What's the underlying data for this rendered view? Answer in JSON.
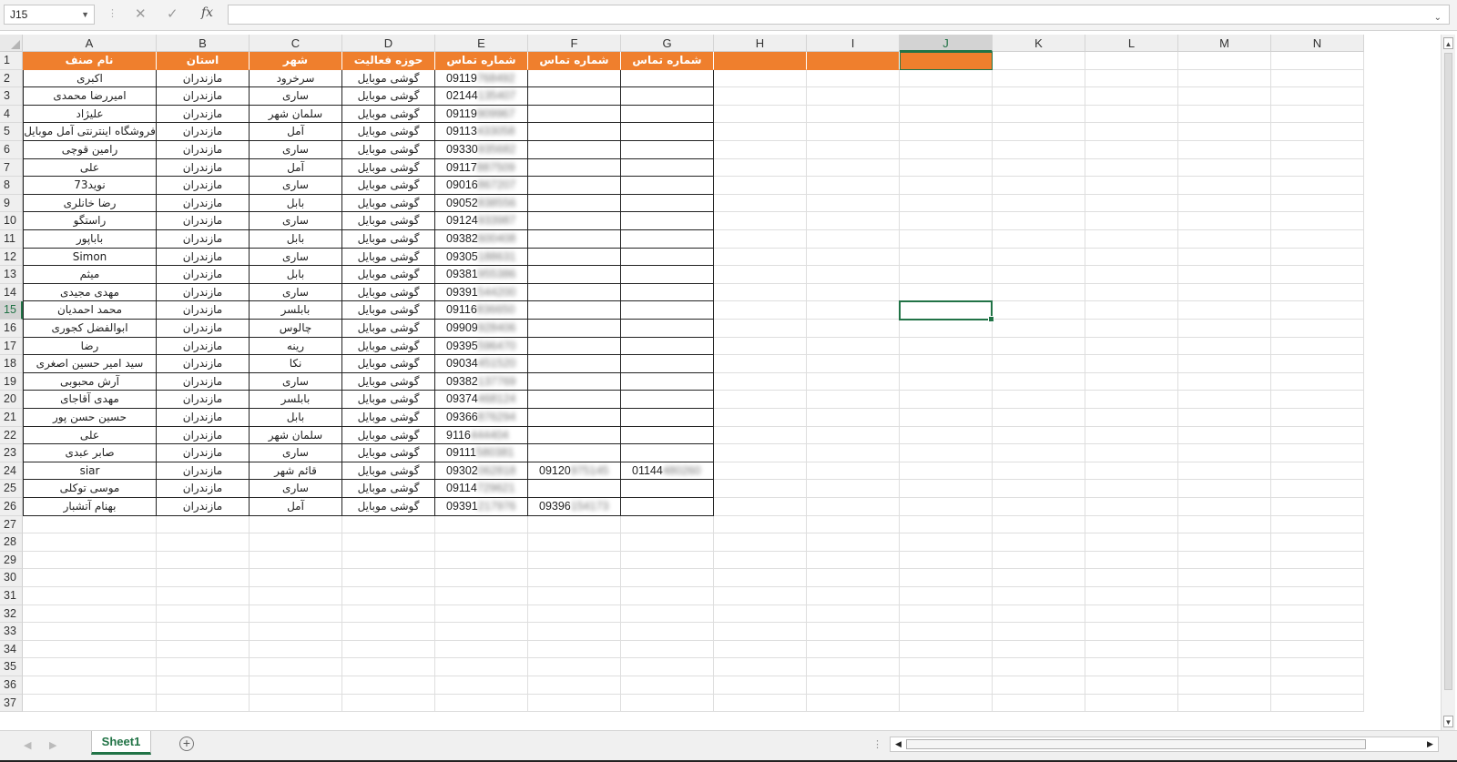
{
  "formula_bar": {
    "name_box": "J15",
    "cancel_icon": "✕",
    "enter_icon": "✓",
    "fx_label": "fx",
    "formula_value": ""
  },
  "columns": [
    "A",
    "B",
    "C",
    "D",
    "E",
    "F",
    "G",
    "H",
    "I",
    "J",
    "K",
    "L",
    "M",
    "N"
  ],
  "selected_column": "J",
  "selected_row": 15,
  "row_numbers": [
    1,
    2,
    3,
    4,
    5,
    6,
    7,
    8,
    9,
    10,
    11,
    12,
    13,
    14,
    15,
    16,
    17,
    18,
    19,
    20,
    21,
    22,
    23,
    24,
    25,
    26,
    27,
    28,
    29,
    30,
    31,
    32,
    33,
    34,
    35,
    36,
    37
  ],
  "header_row": [
    "نام صنف",
    "استان",
    "شهر",
    "حوزه فعالیت",
    "شماره تماس",
    "شماره تماس",
    "شماره تماس"
  ],
  "data_rows": [
    [
      "اکبری",
      "مازندران",
      "سرخرود",
      "گوشی موبایل",
      [
        "09119",
        "768492"
      ],
      null,
      null
    ],
    [
      "امیررضا محمدی",
      "مازندران",
      "ساری",
      "گوشی موبایل",
      [
        "02144",
        "135407"
      ],
      null,
      null
    ],
    [
      "علیژاد",
      "مازندران",
      "سلمان شهر",
      "گوشی موبایل",
      [
        "09119",
        "909967"
      ],
      null,
      null
    ],
    [
      "فروشگاه اینترنتی آمل موبایل",
      "مازندران",
      "آمل",
      "گوشی موبایل",
      [
        "09113",
        "433058"
      ],
      null,
      null
    ],
    [
      "رامین قوچی",
      "مازندران",
      "ساری",
      "گوشی موبایل",
      [
        "09330",
        "935682"
      ],
      null,
      null
    ],
    [
      "علی",
      "مازندران",
      "آمل",
      "گوشی موبایل",
      [
        "09117",
        "887509"
      ],
      null,
      null
    ],
    [
      "نوید73",
      "مازندران",
      "ساری",
      "گوشی موبایل",
      [
        "09016",
        "867207"
      ],
      null,
      null
    ],
    [
      "رضا خانلری",
      "مازندران",
      "بابل",
      "گوشی موبایل",
      [
        "09052",
        "838556"
      ],
      null,
      null
    ],
    [
      "راستگو",
      "مازندران",
      "ساری",
      "گوشی موبایل",
      [
        "09124",
        "933987"
      ],
      null,
      null
    ],
    [
      "باباپور",
      "مازندران",
      "بابل",
      "گوشی موبایل",
      [
        "09382",
        "600408"
      ],
      null,
      null
    ],
    [
      "Simon",
      "مازندران",
      "ساری",
      "گوشی موبایل",
      [
        "09305",
        "188631"
      ],
      null,
      null
    ],
    [
      "میثم",
      "مازندران",
      "بابل",
      "گوشی موبایل",
      [
        "09381",
        "955386"
      ],
      null,
      null
    ],
    [
      "مهدی مجیدی",
      "مازندران",
      "ساری",
      "گوشی موبایل",
      [
        "09391",
        "544200"
      ],
      null,
      null
    ],
    [
      "محمد احمدیان",
      "مازندران",
      "بابلسر",
      "گوشی موبایل",
      [
        "09116",
        "836650"
      ],
      null,
      null
    ],
    [
      "ابوالفضل کجوری",
      "مازندران",
      "چالوس",
      "گوشی موبایل",
      [
        "09909",
        "928406"
      ],
      null,
      null
    ],
    [
      "رضا",
      "مازندران",
      "رینه",
      "گوشی موبایل",
      [
        "09395",
        "596470"
      ],
      null,
      null
    ],
    [
      "سید امیر حسین اصغری",
      "مازندران",
      "نکا",
      "گوشی موبایل",
      [
        "09034",
        "451520"
      ],
      null,
      null
    ],
    [
      "آرش محبوبی",
      "مازندران",
      "ساری",
      "گوشی موبایل",
      [
        "09382",
        "137769"
      ],
      null,
      null
    ],
    [
      "مهدی آقاجای",
      "مازندران",
      "بابلسر",
      "گوشی موبایل",
      [
        "09374",
        "468124"
      ],
      null,
      null
    ],
    [
      "حسین حسن پور",
      "مازندران",
      "بابل",
      "گوشی موبایل",
      [
        "09366",
        "876294"
      ],
      null,
      null
    ],
    [
      "علی",
      "مازندران",
      "سلمان شهر",
      "گوشی موبایل",
      [
        "9116",
        "444404"
      ],
      null,
      null
    ],
    [
      "صابر عبدی",
      "مازندران",
      "ساری",
      "گوشی موبایل",
      [
        "09111",
        "580381"
      ],
      null,
      null
    ],
    [
      "siar",
      "مازندران",
      "قائم شهر",
      "گوشی موبایل",
      [
        "09302",
        "062818"
      ],
      [
        "09120",
        "975145"
      ],
      [
        "01144",
        "480260"
      ]
    ],
    [
      "موسی توکلی",
      "مازندران",
      "ساری",
      "گوشی موبایل",
      [
        "09114",
        "729621"
      ],
      null,
      null
    ],
    [
      "بهنام آتشبار",
      "مازندران",
      "آمل",
      "گوشی موبایل",
      [
        "09391",
        "217976"
      ],
      [
        "09396",
        "154173"
      ],
      null
    ]
  ],
  "sheet_tab": "Sheet1",
  "add_sheet_icon": "+",
  "colors": {
    "header_fill": "#ef7f2d",
    "accent": "#217346"
  }
}
